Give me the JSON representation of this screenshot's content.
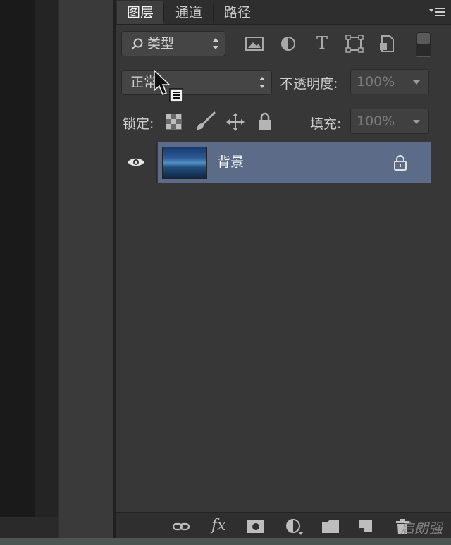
{
  "tabs": [
    {
      "label": "图层",
      "active": true
    },
    {
      "label": "通道",
      "active": false
    },
    {
      "label": "路径",
      "active": false
    }
  ],
  "filter": {
    "kind_label": "类型",
    "icons": [
      "image-filter-icon",
      "adjustment-filter-icon",
      "type-filter-icon",
      "shape-filter-icon",
      "smart-object-filter-icon"
    ]
  },
  "blend": {
    "mode_label": "正常",
    "opacity_label": "不透明度:",
    "opacity_value": "100%"
  },
  "lock": {
    "label": "锁定:",
    "fill_label": "填充:",
    "fill_value": "100%"
  },
  "layers": [
    {
      "name": "背景",
      "visible": true,
      "locked": true,
      "selected": true
    }
  ],
  "footer": {
    "icons": [
      "link-layers-icon",
      "fx-icon",
      "add-mask-icon",
      "adjustment-layer-icon",
      "new-group-icon",
      "new-layer-icon",
      "delete-layer-icon"
    ],
    "fx_label": "fx",
    "watermark": "启朗强"
  },
  "colors": {
    "panel_bg": "#373737",
    "selected_layer": "#5b6b88"
  }
}
